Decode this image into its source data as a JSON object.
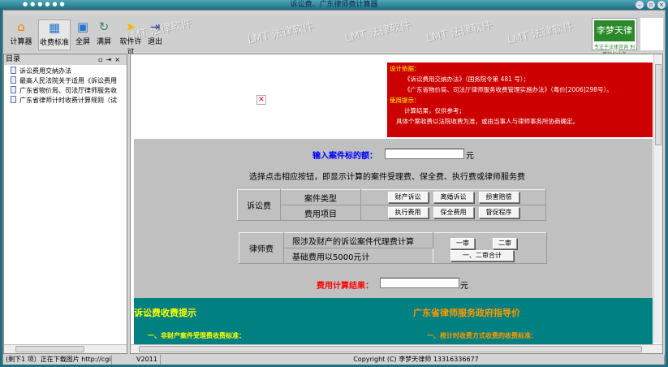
{
  "window": {
    "title": "诉讼费、广东律师费计算器",
    "controls": [
      "minimize",
      "restore",
      "close"
    ]
  },
  "toolbar": {
    "buttons": [
      {
        "label": "计算器",
        "icon": "house-icon"
      },
      {
        "label": "收费标准",
        "icon": "table-icon"
      },
      {
        "label": "全屏",
        "icon": "fullscreen-icon"
      },
      {
        "label": "满屏",
        "icon": "refresh-icon"
      },
      {
        "label": "软件许可",
        "icon": "cursor-icon"
      },
      {
        "label": "退出",
        "icon": "exit-icon"
      }
    ],
    "watermark": "LMT 法律软件",
    "logo_text": "李梦天律师",
    "logo_sub": "专注于法律咨询 刑事辩护业务"
  },
  "sidebar": {
    "title": "目录",
    "items": [
      "诉讼费用交纳办法",
      "最高人民法院关于适用《诉讼费用",
      "广东省物价局、司法厅律师服务收",
      "广东省律师计时收费计算规则（试"
    ]
  },
  "notice": {
    "heading1": "设计依据：",
    "line1": "《诉讼费用交纳办法》（国务院令第 481 号）；",
    "line2": "《广东省物价局、司法厅律师服务收费管理实施办法》（粤价[2006]298号）。",
    "heading2": "使用提示：",
    "line3": "计算结果，仅供参考；",
    "line4": "具体个案收费以法院收费为准，或由当事人与律师事务所协商确定。"
  },
  "form": {
    "input_label": "输入案件标的额：",
    "input_value": "",
    "unit": "元",
    "instruction": "选择点击相应按钮，即显示计算的案件受理费、保全费、执行费或律师服务费",
    "litigation": {
      "label": "诉讼费",
      "row1": "案件类型",
      "row2": "费用项目",
      "buttons1": [
        "财产诉讼",
        "离婚诉讼",
        "损害赔偿"
      ],
      "buttons2": [
        "执行费用",
        "保全费用",
        "督促程序"
      ]
    },
    "lawyer": {
      "label": "律师费",
      "row1": "限涉及财产的诉讼案件代理费计算",
      "row2": "基础费用以5000元计",
      "btn_first": "一审",
      "btn_second": "二审",
      "btn_total": "一、二审合计"
    },
    "result_label": "费用计算结果：",
    "result_value": ""
  },
  "teal": {
    "left_title": "诉讼费收费提示",
    "left_sub": "一、非财产案件受理费收费标准：",
    "right_title": "广东省律师服务政府指导价",
    "right_sub": "一、按计时收费方式收费的收费标准："
  },
  "status": {
    "left": "(剩下1 项）正在下载图片 http://cgi.",
    "version": "V2011",
    "copyright": "Copyright (C) 李梦天律师 13316336677"
  }
}
